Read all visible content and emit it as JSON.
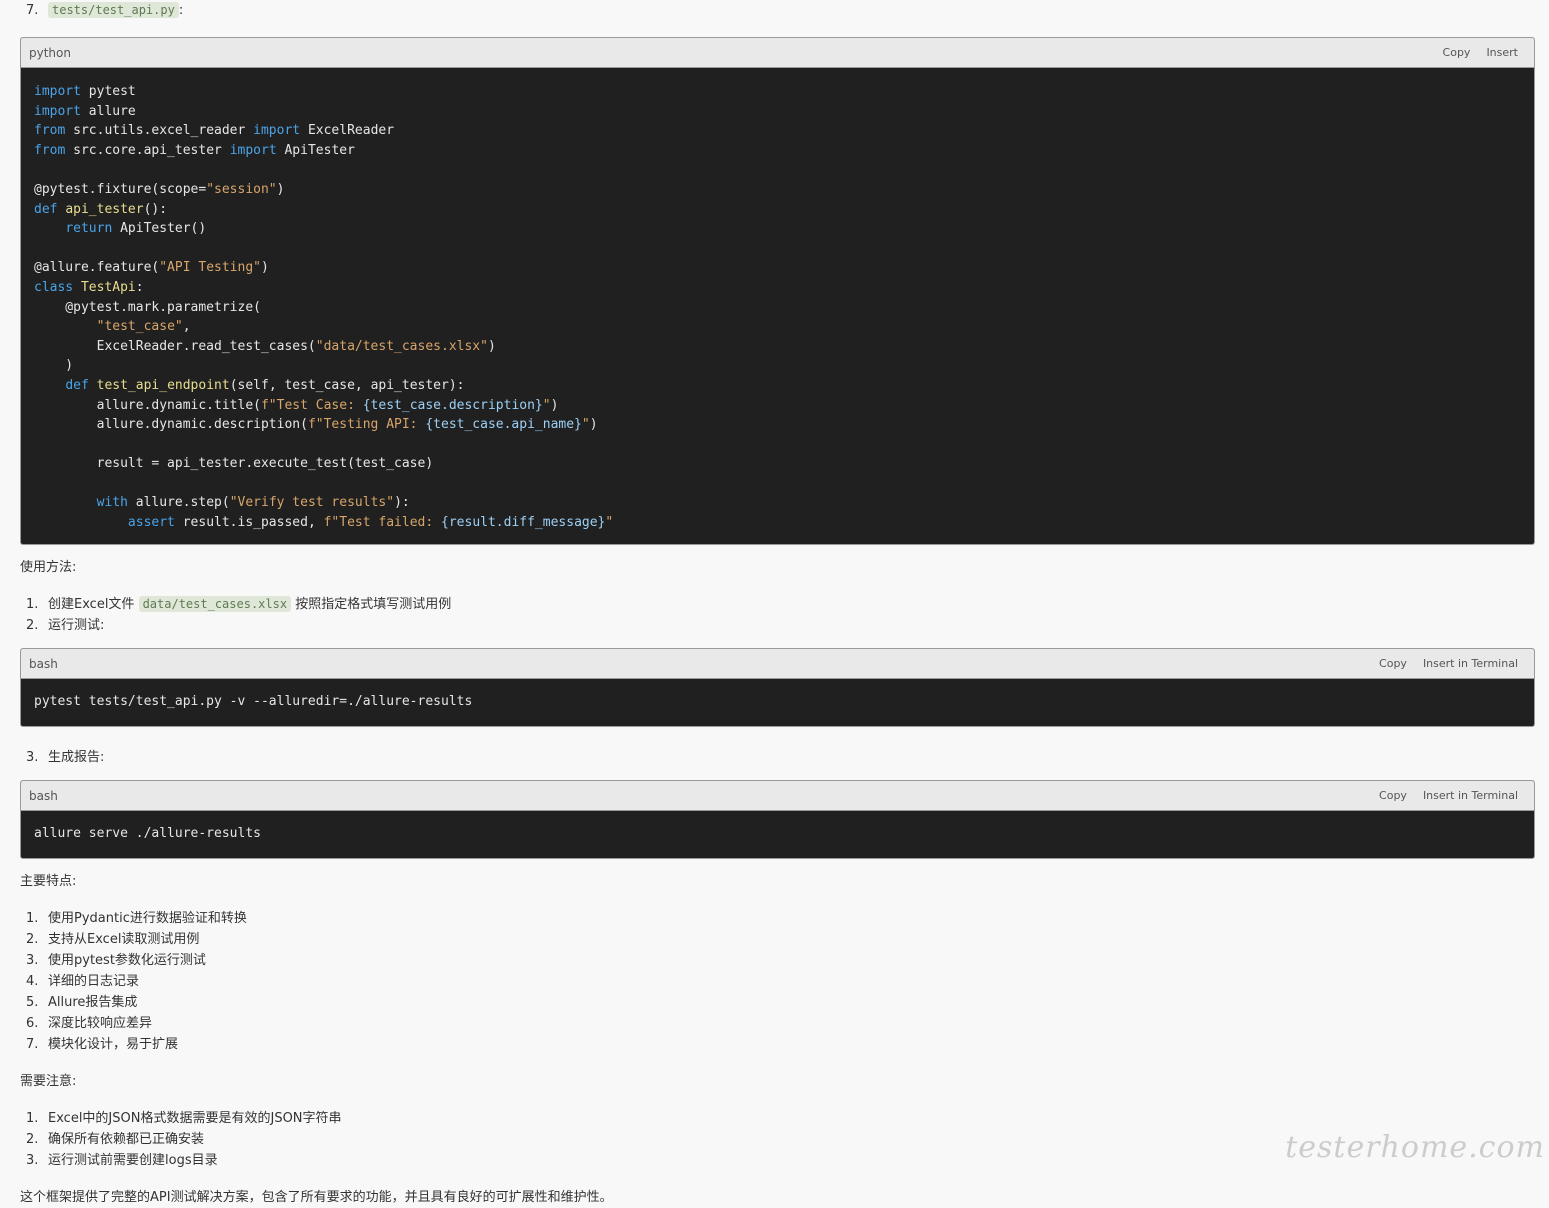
{
  "top_item": {
    "number": "7.",
    "code": "tests/test_api.py",
    "suffix": ":"
  },
  "python_block": {
    "language": "python",
    "copy_label": "Copy",
    "insert_label": "Insert"
  },
  "usage": {
    "heading": "使用方法:",
    "step1": {
      "number": "1.",
      "prefix": "创建Excel文件",
      "code": "data/test_cases.xlsx",
      "suffix": "按照指定格式填写测试用例"
    },
    "step2": {
      "number": "2.",
      "text": "运行测试:"
    },
    "step3": {
      "number": "3.",
      "text": "生成报告:"
    }
  },
  "bash_block_1": {
    "language": "bash",
    "copy_label": "Copy",
    "insert_label": "Insert in Terminal",
    "code": "pytest tests/test_api.py -v --alluredir=./allure-results"
  },
  "bash_block_2": {
    "language": "bash",
    "copy_label": "Copy",
    "insert_label": "Insert in Terminal",
    "code": "allure serve ./allure-results"
  },
  "features": {
    "heading": "主要特点:",
    "items": [
      {
        "number": "1.",
        "text": "使用Pydantic进行数据验证和转换"
      },
      {
        "number": "2.",
        "text": "支持从Excel读取测试用例"
      },
      {
        "number": "3.",
        "text": "使用pytest参数化运行测试"
      },
      {
        "number": "4.",
        "text": "详细的日志记录"
      },
      {
        "number": "5.",
        "text": "Allure报告集成"
      },
      {
        "number": "6.",
        "text": "深度比较响应差异"
      },
      {
        "number": "7.",
        "text": "模块化设计，易于扩展"
      }
    ]
  },
  "notes": {
    "heading": "需要注意:",
    "items": [
      {
        "number": "1.",
        "text": "Excel中的JSON格式数据需要是有效的JSON字符串"
      },
      {
        "number": "2.",
        "text": "确保所有依赖都已正确安装"
      },
      {
        "number": "3.",
        "text": "运行测试前需要创建logs目录"
      }
    ]
  },
  "conclusion": "这个框架提供了完整的API测试解决方案，包含了所有要求的功能，并且具有良好的可扩展性和维护性。",
  "watermark": "testerhome.com"
}
